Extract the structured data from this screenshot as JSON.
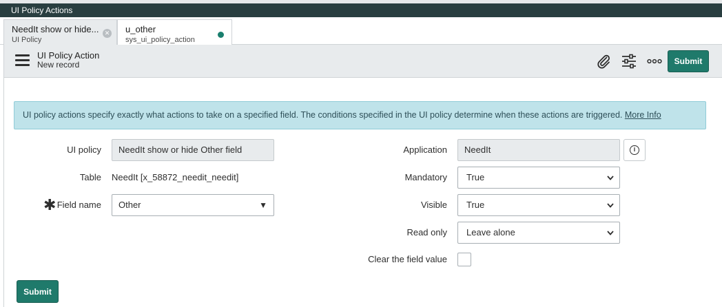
{
  "window": {
    "title": "UI Policy Actions"
  },
  "tabs": [
    {
      "title": "NeedIt show or hide...",
      "subtitle": "UI Policy"
    },
    {
      "title": "u_other",
      "subtitle": "sys_ui_policy_action"
    }
  ],
  "header": {
    "title": "UI Policy Action",
    "subtitle": "New record",
    "submit_label": "Submit"
  },
  "info": {
    "message": "UI policy actions specify exactly what actions to take on a specified field. The conditions specified in the UI policy determine when these actions are triggered.",
    "link": "More Info"
  },
  "form": {
    "ui_policy": {
      "label": "UI policy",
      "value": "NeedIt show or hide Other field"
    },
    "table": {
      "label": "Table",
      "value": "NeedIt [x_58872_needit_needit]"
    },
    "field_name": {
      "label": "Field name",
      "value": "Other",
      "required_mark": "✱"
    },
    "application": {
      "label": "Application",
      "value": "NeedIt"
    },
    "mandatory": {
      "label": "Mandatory",
      "value": "True"
    },
    "visible": {
      "label": "Visible",
      "value": "True"
    },
    "read_only": {
      "label": "Read only",
      "value": "Leave alone"
    },
    "clear_value": {
      "label": "Clear the field value",
      "checked": false
    }
  },
  "footer": {
    "submit_label": "Submit"
  },
  "colors": {
    "accent": "#1f7a6b",
    "title_bar": "#293e40",
    "info_bg": "#bfe3ea"
  }
}
